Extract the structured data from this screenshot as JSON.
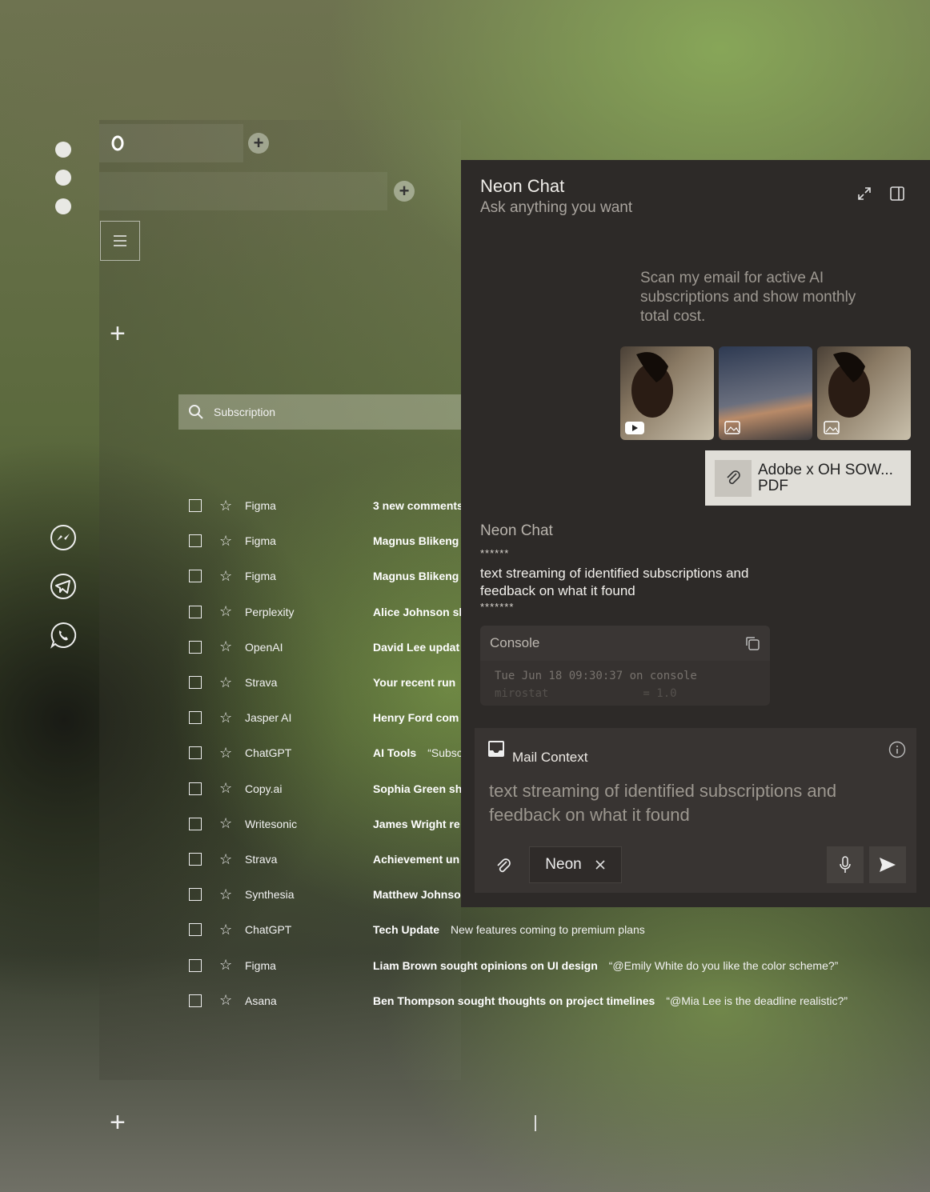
{
  "search": {
    "value": "Subscription"
  },
  "emails": [
    {
      "sender": "Figma",
      "subject": "3 new comments",
      "snippet": ""
    },
    {
      "sender": "Figma",
      "subject": "Magnus Blikeng",
      "snippet": ""
    },
    {
      "sender": "Figma",
      "subject": "Magnus Blikeng",
      "snippet": ""
    },
    {
      "sender": "Perplexity",
      "subject": "Alice Johnson sh",
      "snippet": ""
    },
    {
      "sender": "OpenAI",
      "subject": "David Lee updat",
      "snippet": ""
    },
    {
      "sender": "Strava",
      "subject": "Your recent run",
      "snippet": ""
    },
    {
      "sender": "Jasper AI",
      "subject": "Henry Ford com",
      "snippet": ""
    },
    {
      "sender": "ChatGPT",
      "subject": "AI Tools",
      "snippet": "“Subsc"
    },
    {
      "sender": "Copy.ai",
      "subject": "Sophia Green sh",
      "snippet": ""
    },
    {
      "sender": "Writesonic",
      "subject": "James Wright re",
      "snippet": ""
    },
    {
      "sender": "Strava",
      "subject": "Achievement un",
      "snippet": ""
    },
    {
      "sender": "Synthesia",
      "subject": "Matthew Johnso",
      "snippet": ""
    },
    {
      "sender": "ChatGPT",
      "subject": "Tech Update",
      "snippet": "New features coming to premium plans"
    },
    {
      "sender": "Figma",
      "subject": "Liam Brown sought opinions on UI design",
      "snippet": "“@Emily White do you like the color scheme?”"
    },
    {
      "sender": "Asana",
      "subject": "Ben Thompson sought thoughts on project timelines",
      "snippet": "“@Mia Lee is the deadline realistic?”"
    }
  ],
  "chat": {
    "title": "Neon Chat",
    "subtitle": "Ask anything you want",
    "user_message": "Scan my email for active AI subscriptions and show monthly total cost.",
    "attachment": {
      "name": "Adobe x OH SOW...",
      "type": "PDF"
    },
    "bot_name": "Neon Chat",
    "stars_top": "******",
    "bot_text": "text streaming of identified subscriptions and feedback on what it found",
    "stars_bottom": "*******",
    "console": {
      "label": "Console",
      "line1": "Tue Jun 18 09:30:37 on console",
      "line2": "mirostat              = 1.0"
    }
  },
  "composer": {
    "title": "Mail Context",
    "text": "text streaming of identified subscriptions and feedback on what it found",
    "chip_label": "Neon"
  },
  "colors": {
    "panel": "#2d2a28",
    "composer": "#383432",
    "attachment": "#e0ded8"
  }
}
